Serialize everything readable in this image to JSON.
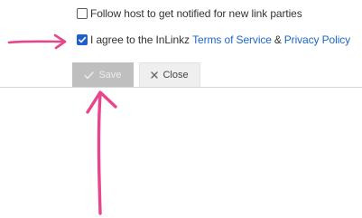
{
  "follow": {
    "checked": false,
    "label": "Follow host to get notified for new link parties"
  },
  "agree": {
    "checked": true,
    "prefix": "I agree to the InLinkz",
    "terms_link": "Terms of Service",
    "amp": "&",
    "privacy_link": "Privacy Policy"
  },
  "toolbar": {
    "save_label": "Save",
    "save_icon": "check-icon",
    "close_label": "Close",
    "close_icon": "x-icon"
  },
  "colors": {
    "checkbox_checked": "#1c5fd1",
    "link": "#1c66c9",
    "save_button_bg": "#bfbfbf",
    "annotation": "#e8468a"
  }
}
